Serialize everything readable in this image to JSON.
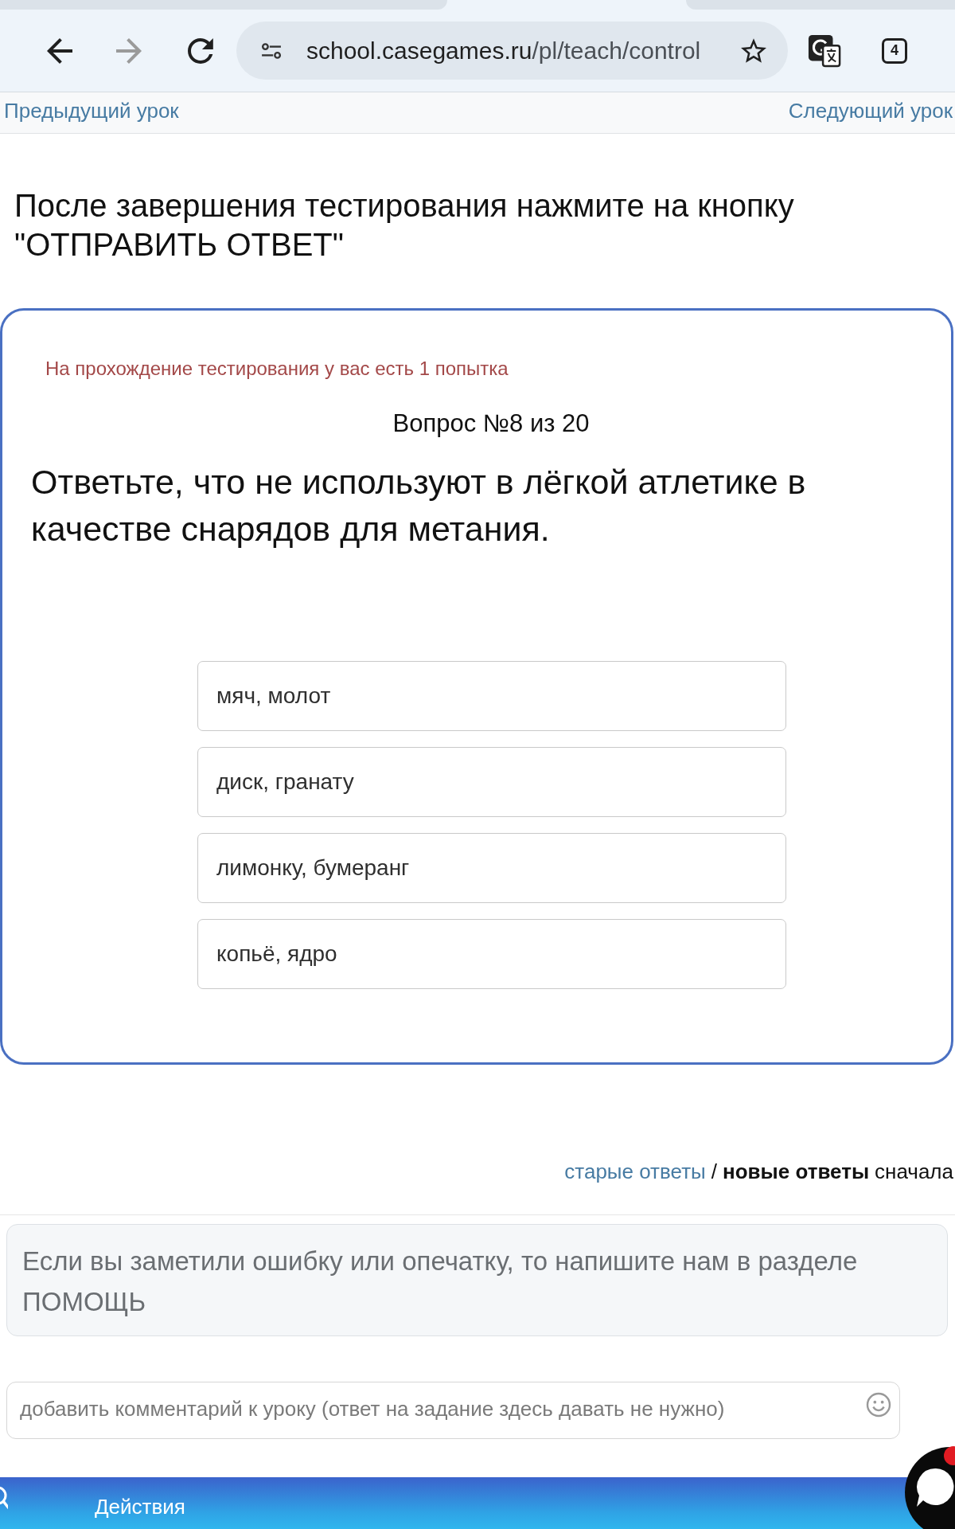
{
  "browser": {
    "back": {
      "disabled": false
    },
    "forward": {
      "disabled": true
    },
    "url": {
      "host": "school.casegames.ru",
      "path": "/pl/teach/control"
    },
    "tab_count": "4"
  },
  "lesson_nav": {
    "previous": "Предыдущий урок",
    "next": "Следующий урок"
  },
  "instruction": "После завершения тестирования нажмите на кнопку \"ОТПРАВИТЬ ОТВЕТ\"",
  "quiz": {
    "attempts_note": "На прохождение тестирования у вас есть 1 попытка",
    "counter": "Вопрос №8 из 20",
    "question": "Ответьте, что не используют в лёгкой атлетике в качестве снарядов для метания.",
    "answers": [
      {
        "label": "мяч, молот",
        "selected": false
      },
      {
        "label": "диск, гранату",
        "selected": false
      },
      {
        "label": "лимонку, бумеранг",
        "selected": false
      },
      {
        "label": "копьё, ядро",
        "selected": false
      }
    ]
  },
  "comments": {
    "sort_options": [
      {
        "label": "старые ответы",
        "selected": false
      },
      {
        "label": "новые ответы",
        "selected": true
      }
    ],
    "separator": "/",
    "sort_suffix": "сначала",
    "notice": "Если вы заметили ошибку или опечатку, то напишите нам в разделе ПОМОЩЬ",
    "comment_input": {
      "placeholder": "добавить комментарий к уроку (ответ на задание здесь давать не нужно)"
    }
  },
  "bottom_bar": {
    "label": "Действия"
  }
}
